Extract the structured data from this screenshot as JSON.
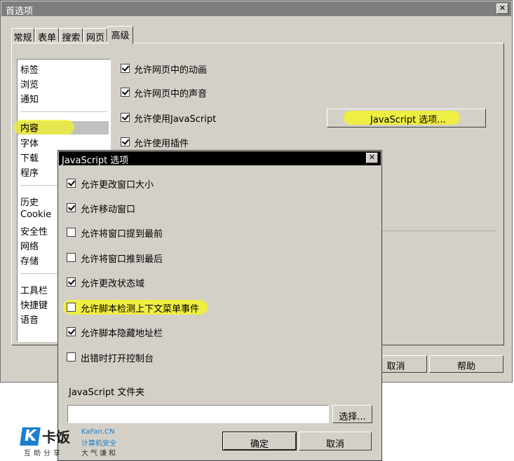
{
  "main_window": {
    "title": "首选项",
    "close_glyph": "✕",
    "tabs": [
      {
        "label": "常规"
      },
      {
        "label": "表单"
      },
      {
        "label": "搜索"
      },
      {
        "label": "网页"
      },
      {
        "label": "高级",
        "active": true
      }
    ],
    "categories": {
      "group1": [
        "标签",
        "浏览",
        "通知"
      ],
      "group2": [
        "内容",
        "字体",
        "下载",
        "程序"
      ],
      "group3": [
        "历史",
        "Cookie",
        "安全性",
        "网络",
        "存储"
      ],
      "group4": [
        "工具栏",
        "快捷键",
        "语音"
      ],
      "selected": "内容"
    },
    "options": [
      {
        "label": "允许网页中的动画",
        "checked": true
      },
      {
        "label": "允许网页中的声音",
        "checked": true
      },
      {
        "label": "允许使用JavaScript",
        "checked": true
      },
      {
        "label": "允许使用插件",
        "checked": true
      }
    ],
    "js_options_button": "JavaScript 选项...",
    "cancel_button": "取消",
    "help_button": "帮助"
  },
  "js_dialog": {
    "title": "JavaScript 选项",
    "close_glyph": "✕",
    "options": [
      {
        "label": "允许更改窗口大小",
        "checked": true
      },
      {
        "label": "允许移动窗口",
        "checked": true
      },
      {
        "label": "允许将窗口提到最前",
        "checked": false
      },
      {
        "label": "允许将窗口推到最后",
        "checked": false
      },
      {
        "label": "允许更改状态域",
        "checked": true
      },
      {
        "label": "允许脚本检测上下文菜单事件",
        "checked": false,
        "highlighted": true
      },
      {
        "label": "允许脚本隐藏地址栏",
        "checked": true
      },
      {
        "label": "出错时打开控制台",
        "checked": false
      }
    ],
    "folder_label": "JavaScript 文件夹",
    "folder_value": "",
    "choose_button": "选择...",
    "ok_button": "确定",
    "cancel_button": "取消"
  },
  "watermark": {
    "logo_letter": "K",
    "brand": "卡饭",
    "subtitle": "互助分享",
    "site": "KaFan.CN",
    "tagline": "计算机安全",
    "motto": "大气谦和"
  },
  "colors": {
    "highlight": "#f3f32a",
    "dialog_title": "#000000",
    "window_title": "#7e7e7e",
    "face": "#d4d0c8",
    "logo_blue": "#1b7fd0"
  }
}
